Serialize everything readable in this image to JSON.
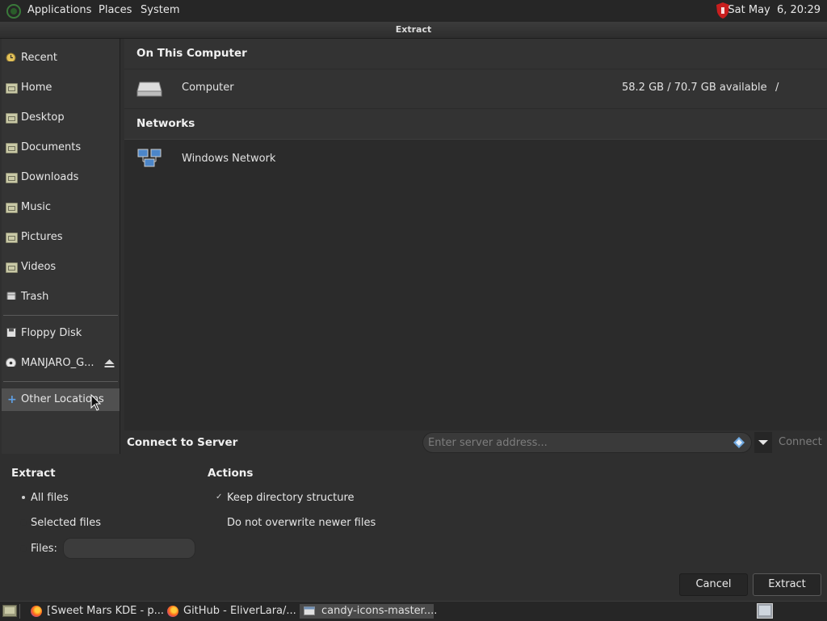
{
  "top_panel": {
    "menus": [
      "Applications",
      "Places",
      "System"
    ],
    "clock": "Sat May  6, 20:29"
  },
  "window": {
    "title": "Extract"
  },
  "sidebar": {
    "items": [
      {
        "label": "Recent",
        "icon": "clock-icon"
      },
      {
        "label": "Home",
        "icon": "home-folder-icon"
      },
      {
        "label": "Desktop",
        "icon": "desktop-folder-icon"
      },
      {
        "label": "Documents",
        "icon": "documents-folder-icon"
      },
      {
        "label": "Downloads",
        "icon": "downloads-folder-icon"
      },
      {
        "label": "Music",
        "icon": "music-folder-icon"
      },
      {
        "label": "Pictures",
        "icon": "pictures-folder-icon"
      },
      {
        "label": "Videos",
        "icon": "videos-folder-icon"
      },
      {
        "label": "Trash",
        "icon": "trash-icon"
      }
    ],
    "devices": [
      {
        "label": "Floppy Disk",
        "icon": "floppy-icon"
      },
      {
        "label": "MANJARO_G...",
        "icon": "optical-disc-icon",
        "eject": "eject-icon"
      }
    ],
    "other_locations": {
      "label": "Other Locations",
      "icon": "plus-icon"
    }
  },
  "places": {
    "on_this_computer": {
      "header": "On This Computer",
      "items": [
        {
          "name": "Computer",
          "space": "58.2 GB / 70.7 GB available",
          "path": "/"
        }
      ]
    },
    "networks": {
      "header": "Networks",
      "items": [
        {
          "name": "Windows Network"
        }
      ]
    }
  },
  "connect": {
    "label": "Connect to Server",
    "placeholder": "Enter server address...",
    "button": "Connect"
  },
  "extract_options": {
    "header": "Extract",
    "all_files": "All files",
    "selected_files": "Selected files",
    "files": "Files:",
    "selected": "all_files"
  },
  "actions": {
    "header": "Actions",
    "keep_structure": "Keep directory structure",
    "keep_structure_checked": true,
    "no_overwrite": "Do not overwrite newer files",
    "no_overwrite_checked": false
  },
  "buttons": {
    "cancel": "Cancel",
    "extract": "Extract"
  },
  "taskbar": {
    "tasks": [
      "[Sweet Mars KDE - p...",
      "GitHub - EliverLara/...",
      "candy-icons-master...."
    ],
    "active_index": 2
  }
}
